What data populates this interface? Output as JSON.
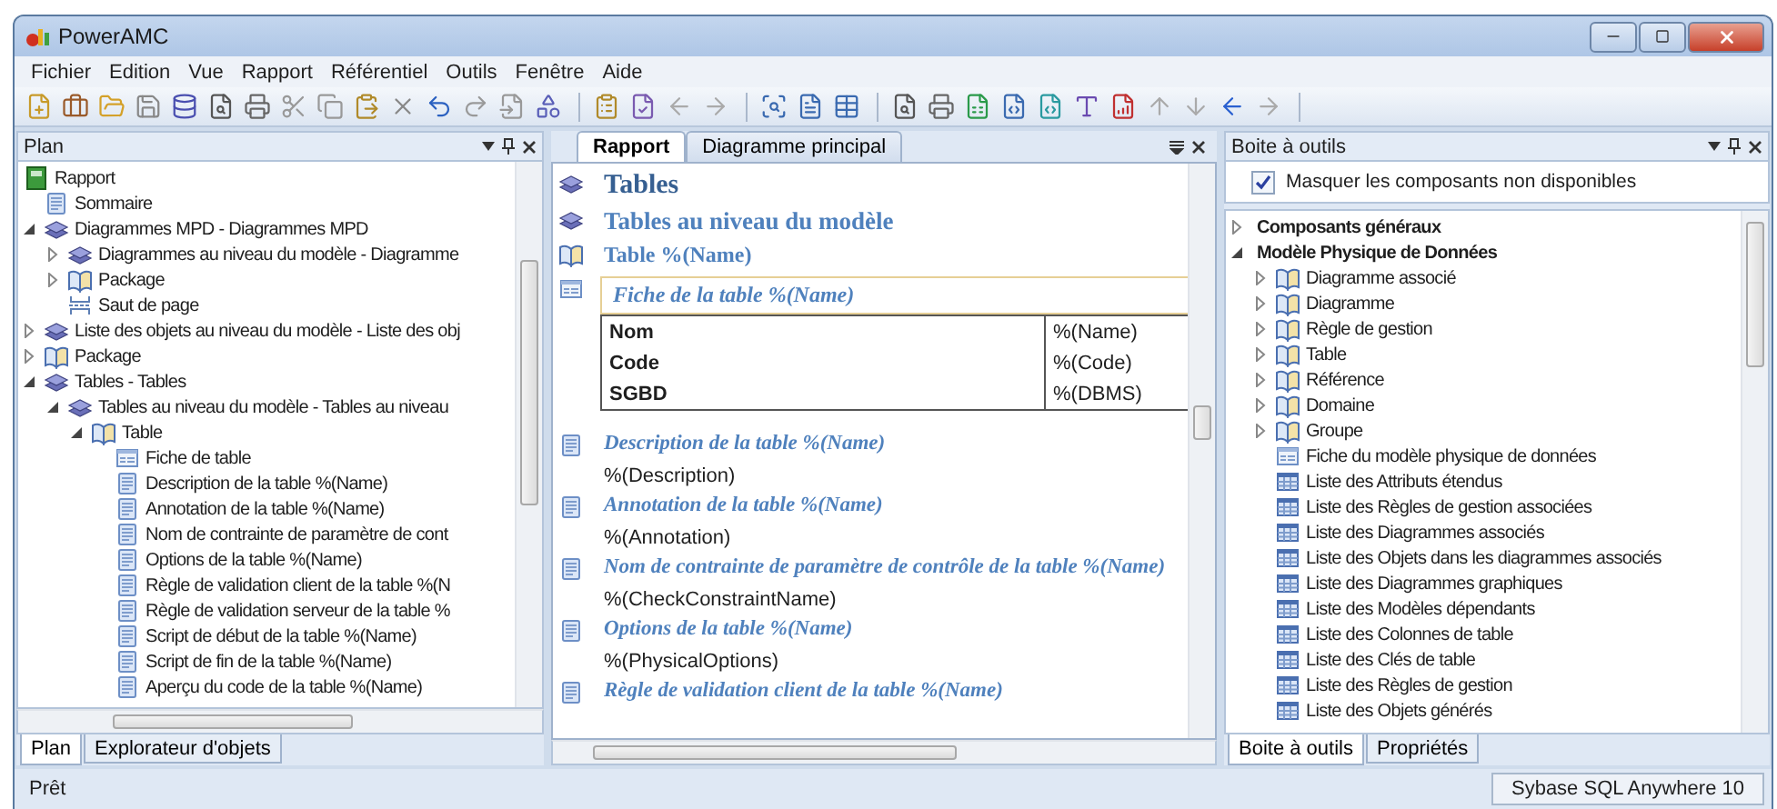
{
  "window": {
    "title": "PowerAMC"
  },
  "menu": [
    "Fichier",
    "Edition",
    "Vue",
    "Rapport",
    "Référentiel",
    "Outils",
    "Fenêtre",
    "Aide"
  ],
  "plan_panel": {
    "title": "Plan",
    "tree": [
      {
        "label": "Rapport",
        "kind": "report",
        "children": [
          {
            "label": "Sommaire",
            "kind": "page"
          },
          {
            "label": "Diagrammes MPD - Diagrammes MPD",
            "kind": "books",
            "expanded": true,
            "children": [
              {
                "label": "Diagrammes au niveau du modèle - Diagramme",
                "kind": "books",
                "expanded": false
              },
              {
                "label": "Package",
                "kind": "package",
                "expanded": false
              },
              {
                "label": "Saut de page",
                "kind": "break"
              }
            ]
          },
          {
            "label": "Liste des objets au niveau du modèle - Liste des obj",
            "kind": "books",
            "expanded": false
          },
          {
            "label": "Package",
            "kind": "package",
            "expanded": false
          },
          {
            "label": "Tables - Tables",
            "kind": "books",
            "expanded": true,
            "children": [
              {
                "label": "Tables au niveau du modèle - Tables au niveau",
                "kind": "books",
                "expanded": true,
                "children": [
                  {
                    "label": "Table",
                    "kind": "package",
                    "expanded": true,
                    "children": [
                      {
                        "label": "Fiche de table",
                        "kind": "form"
                      },
                      {
                        "label": "Description de la table %(Name)",
                        "kind": "page"
                      },
                      {
                        "label": "Annotation de la table %(Name)",
                        "kind": "page"
                      },
                      {
                        "label": "Nom de contrainte de paramètre de cont",
                        "kind": "page"
                      },
                      {
                        "label": "Options de la table %(Name)",
                        "kind": "page"
                      },
                      {
                        "label": "Règle de validation client de la table %(N",
                        "kind": "page"
                      },
                      {
                        "label": "Règle de validation serveur de la table %",
                        "kind": "page"
                      },
                      {
                        "label": "Script de début de la table %(Name)",
                        "kind": "page"
                      },
                      {
                        "label": "Script de fin de la table %(Name)",
                        "kind": "page"
                      },
                      {
                        "label": "Aperçu du code de la table %(Name)",
                        "kind": "page"
                      }
                    ]
                  }
                ]
              }
            ]
          }
        ]
      }
    ],
    "tabs": [
      {
        "label": "Plan",
        "selected": true
      },
      {
        "label": "Explorateur d'objets",
        "selected": false
      }
    ]
  },
  "editor": {
    "tabs": [
      {
        "label": "Rapport",
        "selected": true
      },
      {
        "label": "Diagramme principal",
        "selected": false
      }
    ],
    "blocks": [
      {
        "kind": "title",
        "text": "Tables"
      },
      {
        "kind": "subtitle",
        "text": "Tables au niveau du modèle"
      },
      {
        "kind": "section",
        "text": "Table %(Name)"
      },
      {
        "kind": "card",
        "text": "Fiche de la table %(Name)",
        "rows": [
          [
            "Nom",
            "%(Name)"
          ],
          [
            "Code",
            "%(Code)"
          ],
          [
            "SGBD",
            "%(DBMS)"
          ]
        ]
      },
      {
        "kind": "heading",
        "text": "Description de la table %(Name)"
      },
      {
        "kind": "text",
        "text": "%(Description)"
      },
      {
        "kind": "heading",
        "text": "Annotation de la table %(Name)"
      },
      {
        "kind": "text",
        "text": "%(Annotation)"
      },
      {
        "kind": "heading",
        "text": "Nom de contrainte de paramètre de contrôle de la table %(Name)"
      },
      {
        "kind": "text",
        "text": "%(CheckConstraintName)"
      },
      {
        "kind": "heading",
        "text": "Options de la table %(Name)"
      },
      {
        "kind": "text",
        "text": "%(PhysicalOptions)"
      },
      {
        "kind": "heading",
        "text": "Règle de validation client de la table %(Name)"
      }
    ]
  },
  "toolbox_panel": {
    "title": "Boite à outils",
    "checkbox": {
      "label": "Masquer les composants non disponibles",
      "checked": true
    },
    "tree": [
      {
        "label": "Composants généraux",
        "kind": "group",
        "expanded": false
      },
      {
        "label": "Modèle Physique de Données",
        "kind": "group",
        "expanded": true,
        "children": [
          {
            "label": "Diagramme associé",
            "kind": "package",
            "expanded": false
          },
          {
            "label": "Diagramme",
            "kind": "package",
            "expanded": false
          },
          {
            "label": "Règle de gestion",
            "kind": "package",
            "expanded": false
          },
          {
            "label": "Table",
            "kind": "package",
            "expanded": false
          },
          {
            "label": "Référence",
            "kind": "package",
            "expanded": false
          },
          {
            "label": "Domaine",
            "kind": "package",
            "expanded": false
          },
          {
            "label": "Groupe",
            "kind": "package",
            "expanded": false
          },
          {
            "label": "Fiche du modèle physique de données",
            "kind": "form"
          },
          {
            "label": "Liste des Attributs étendus",
            "kind": "list"
          },
          {
            "label": "Liste des Règles de gestion associées",
            "kind": "list"
          },
          {
            "label": "Liste des Diagrammes associés",
            "kind": "list"
          },
          {
            "label": "Liste des Objets dans les diagrammes associés",
            "kind": "list"
          },
          {
            "label": "Liste des Diagrammes graphiques",
            "kind": "list"
          },
          {
            "label": "Liste des Modèles dépendants",
            "kind": "list"
          },
          {
            "label": "Liste des Colonnes de table",
            "kind": "list"
          },
          {
            "label": "Liste des Clés de table",
            "kind": "list"
          },
          {
            "label": "Liste des Règles de gestion",
            "kind": "list"
          },
          {
            "label": "Liste des Objets générés",
            "kind": "list"
          }
        ]
      }
    ],
    "tabs": [
      {
        "label": "Boite à outils",
        "selected": true
      },
      {
        "label": "Propriétés",
        "selected": false
      }
    ]
  },
  "status_bar": {
    "text": "Prêt",
    "database": "Sybase SQL Anywhere 10"
  }
}
